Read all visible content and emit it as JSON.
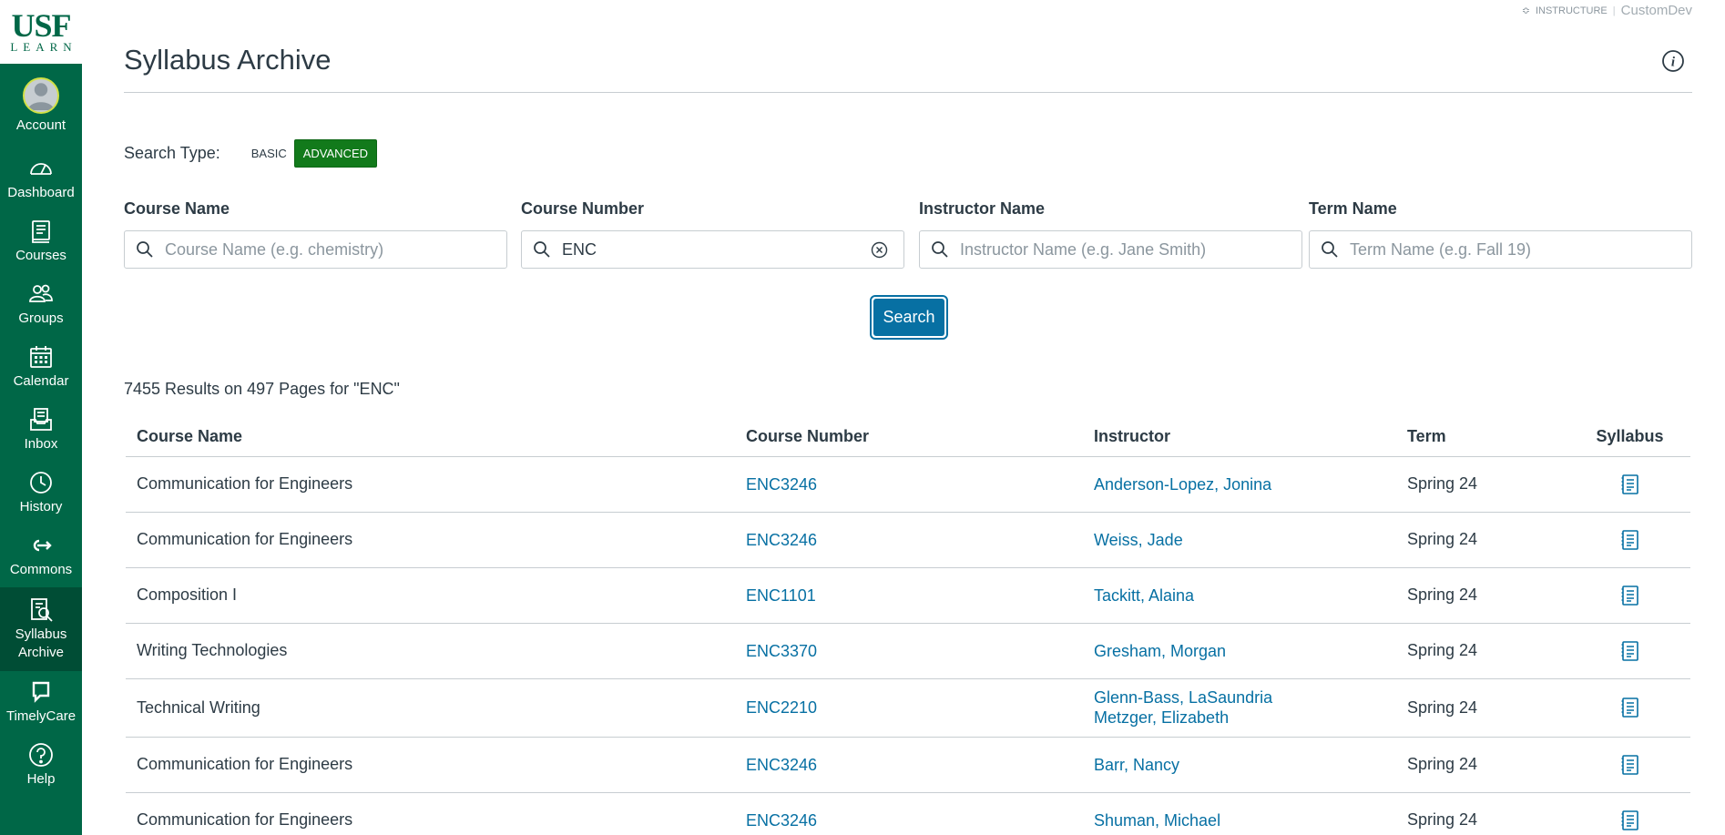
{
  "brand": {
    "instructure": "INSTRUCTURE",
    "custom": "CustomDev"
  },
  "logo": {
    "top": "USF",
    "bottom": "LEARN"
  },
  "nav": [
    {
      "label": "Account",
      "icon": "account-avatar-icon"
    },
    {
      "label": "Dashboard",
      "icon": "dashboard-icon"
    },
    {
      "label": "Courses",
      "icon": "courses-icon"
    },
    {
      "label": "Groups",
      "icon": "groups-icon"
    },
    {
      "label": "Calendar",
      "icon": "calendar-icon"
    },
    {
      "label": "Inbox",
      "icon": "inbox-icon"
    },
    {
      "label": "History",
      "icon": "history-icon"
    },
    {
      "label": "Commons",
      "icon": "commons-icon"
    },
    {
      "label": "Syllabus Archive",
      "icon": "syllabus-archive-icon",
      "active": true
    },
    {
      "label": "TimelyCare",
      "icon": "timelycare-icon"
    },
    {
      "label": "Help",
      "icon": "help-icon"
    }
  ],
  "page": {
    "title": "Syllabus Archive"
  },
  "search_type": {
    "label": "Search Type:",
    "basic": "BASIC",
    "advanced": "ADVANCED",
    "selected": "ADVANCED"
  },
  "fields": {
    "course_name": {
      "label": "Course Name",
      "value": "",
      "placeholder": "Course Name (e.g. chemistry)"
    },
    "course_number": {
      "label": "Course Number",
      "value": "ENC",
      "placeholder": ""
    },
    "instructor_name": {
      "label": "Instructor Name",
      "value": "",
      "placeholder": "Instructor Name (e.g. Jane Smith)"
    },
    "term_name": {
      "label": "Term Name",
      "value": "",
      "placeholder": "Term Name (e.g. Fall 19)"
    }
  },
  "search_button": "Search",
  "results": {
    "summary": "7455 Results on 497 Pages for \"ENC\"",
    "columns": [
      "Course Name",
      "Course Number",
      "Instructor",
      "Term",
      "Syllabus"
    ],
    "rows": [
      {
        "course_name": "Communication for Engineers",
        "course_number": "ENC3246",
        "instructors": [
          "Anderson-Lopez, Jonina"
        ],
        "term": "Spring 24"
      },
      {
        "course_name": "Communication for Engineers",
        "course_number": "ENC3246",
        "instructors": [
          "Weiss, Jade"
        ],
        "term": "Spring 24"
      },
      {
        "course_name": "Composition I",
        "course_number": "ENC1101",
        "instructors": [
          "Tackitt, Alaina"
        ],
        "term": "Spring 24"
      },
      {
        "course_name": "Writing Technologies",
        "course_number": "ENC3370",
        "instructors": [
          "Gresham, Morgan"
        ],
        "term": "Spring 24"
      },
      {
        "course_name": "Technical Writing",
        "course_number": "ENC2210",
        "instructors": [
          "Glenn-Bass, LaSaundria",
          "Metzger, Elizabeth"
        ],
        "term": "Spring 24"
      },
      {
        "course_name": "Communication for Engineers",
        "course_number": "ENC3246",
        "instructors": [
          "Barr, Nancy"
        ],
        "term": "Spring 24"
      },
      {
        "course_name": "Communication for Engineers",
        "course_number": "ENC3246",
        "instructors": [
          "Shuman, Michael"
        ],
        "term": "Spring 24"
      }
    ]
  },
  "colors": {
    "sidebar": "#006747",
    "sidebar_active": "#004d35",
    "link": "#0770a3",
    "advanced": "#127a1b"
  }
}
